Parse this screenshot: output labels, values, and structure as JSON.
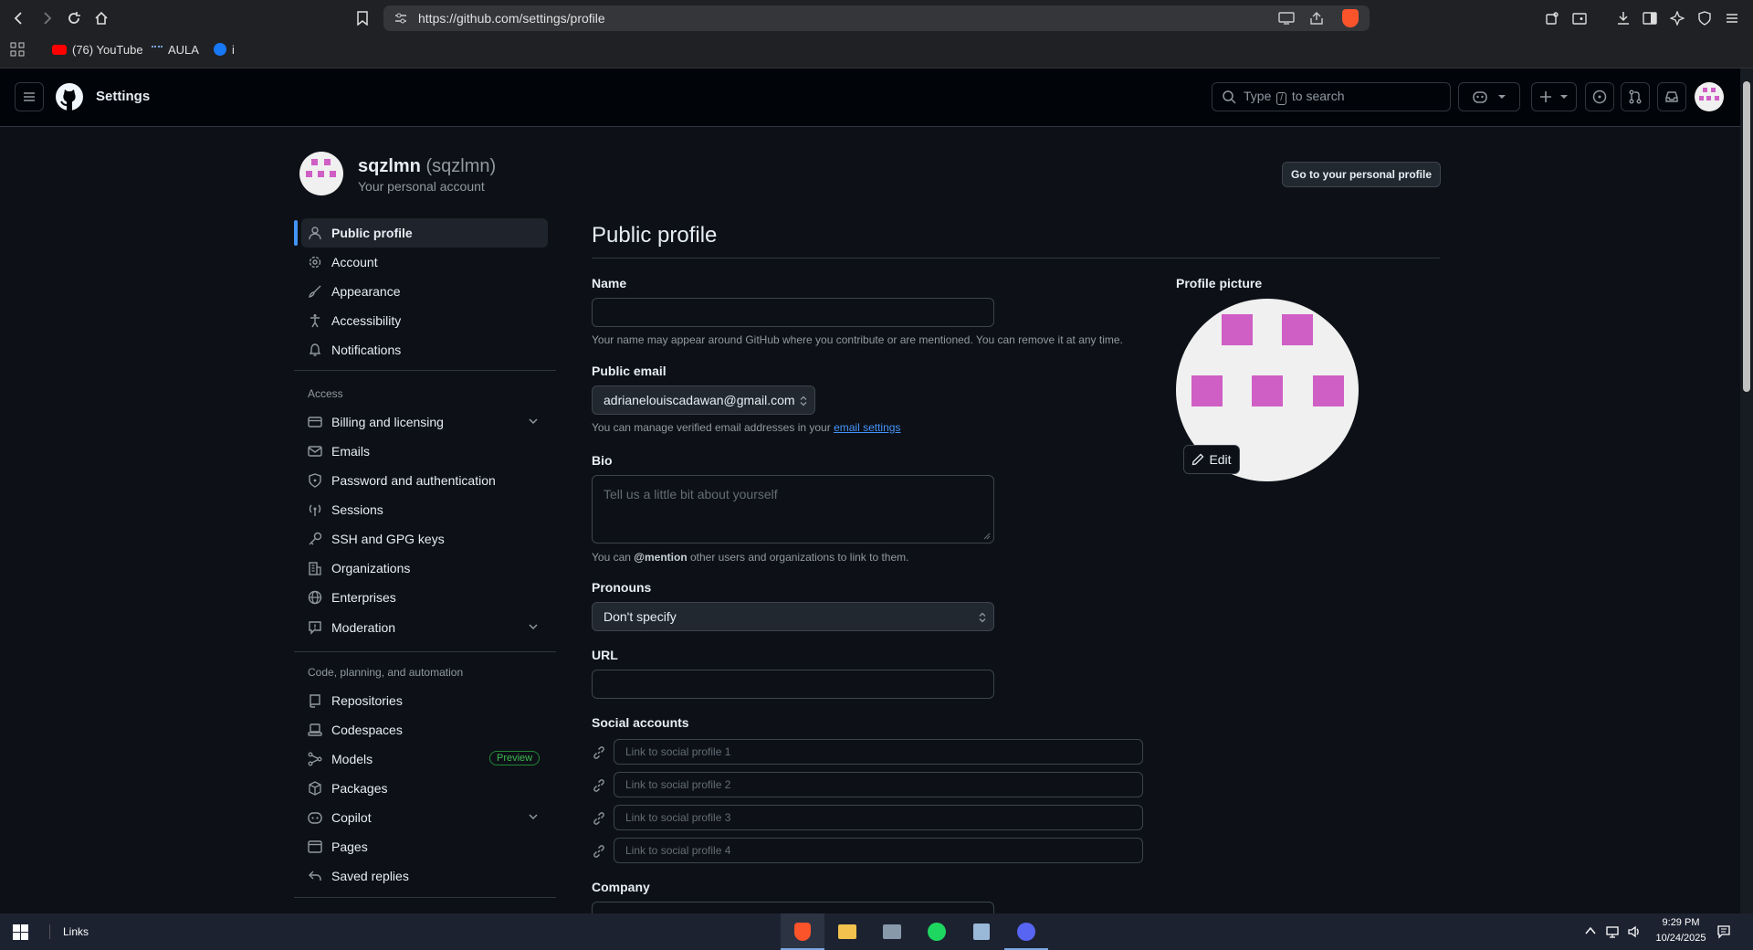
{
  "browser": {
    "url": "https://github.com/settings/profile",
    "bookmarks": [
      {
        "label": "(76) YouTube",
        "icon": "youtube-icon"
      },
      {
        "label": "AULA",
        "icon": "aula-icon"
      },
      {
        "label": "i",
        "icon": "messenger-icon"
      }
    ]
  },
  "header": {
    "title": "Settings",
    "search_prefix": "Type",
    "search_key": "/",
    "search_suffix": "to search"
  },
  "account": {
    "username": "sqzlmn",
    "handle": "(sqzlmn)",
    "subtitle": "Your personal account",
    "go_profile_label": "Go to your personal profile"
  },
  "sidebar": {
    "items_top": [
      {
        "label": "Public profile",
        "icon": "person-icon",
        "active": true
      },
      {
        "label": "Account",
        "icon": "gear-icon"
      },
      {
        "label": "Appearance",
        "icon": "paintbrush-icon"
      },
      {
        "label": "Accessibility",
        "icon": "accessibility-icon"
      },
      {
        "label": "Notifications",
        "icon": "bell-icon"
      }
    ],
    "access_heading": "Access",
    "access_items": [
      {
        "label": "Billing and licensing",
        "icon": "credit-card-icon",
        "expandable": true
      },
      {
        "label": "Emails",
        "icon": "mail-icon"
      },
      {
        "label": "Password and authentication",
        "icon": "shield-lock-icon"
      },
      {
        "label": "Sessions",
        "icon": "broadcast-icon"
      },
      {
        "label": "SSH and GPG keys",
        "icon": "key-icon"
      },
      {
        "label": "Organizations",
        "icon": "organization-icon"
      },
      {
        "label": "Enterprises",
        "icon": "globe-icon"
      },
      {
        "label": "Moderation",
        "icon": "report-icon",
        "expandable": true
      }
    ],
    "code_heading": "Code, planning, and automation",
    "code_items": [
      {
        "label": "Repositories",
        "icon": "repo-icon"
      },
      {
        "label": "Codespaces",
        "icon": "codespaces-icon"
      },
      {
        "label": "Models",
        "icon": "models-icon",
        "badge": "Preview"
      },
      {
        "label": "Packages",
        "icon": "package-icon"
      },
      {
        "label": "Copilot",
        "icon": "copilot-icon",
        "expandable": true
      },
      {
        "label": "Pages",
        "icon": "browser-icon"
      },
      {
        "label": "Saved replies",
        "icon": "reply-icon"
      }
    ]
  },
  "form": {
    "page_title": "Public profile",
    "name_label": "Name",
    "name_value": "",
    "name_note": "Your name may appear around GitHub where you contribute or are mentioned. You can remove it at any time.",
    "email_label": "Public email",
    "email_value": "adrianelouiscadawan@gmail.com",
    "email_note_prefix": "You can manage verified email addresses in your",
    "email_note_link": "email settings",
    "bio_label": "Bio",
    "bio_placeholder": "Tell us a little bit about yourself",
    "bio_note_prefix": "You can",
    "bio_note_mention": "@mention",
    "bio_note_suffix": "other users and organizations to link to them.",
    "pronouns_label": "Pronouns",
    "pronouns_value": "Don't specify",
    "url_label": "URL",
    "url_value": "",
    "social_label": "Social accounts",
    "social_placeholders": [
      "Link to social profile 1",
      "Link to social profile 2",
      "Link to social profile 3",
      "Link to social profile 4"
    ],
    "company_label": "Company",
    "profile_picture_label": "Profile picture",
    "edit_label": "Edit"
  },
  "taskbar": {
    "links_label": "Links",
    "time": "9:29 PM",
    "date": "10/24/2025"
  },
  "colors": {
    "accent": "#4493f8",
    "avatar_pink": "#cf5ec5",
    "avatar_bg": "#f0f0f0",
    "preview_green": "#3fb950"
  }
}
